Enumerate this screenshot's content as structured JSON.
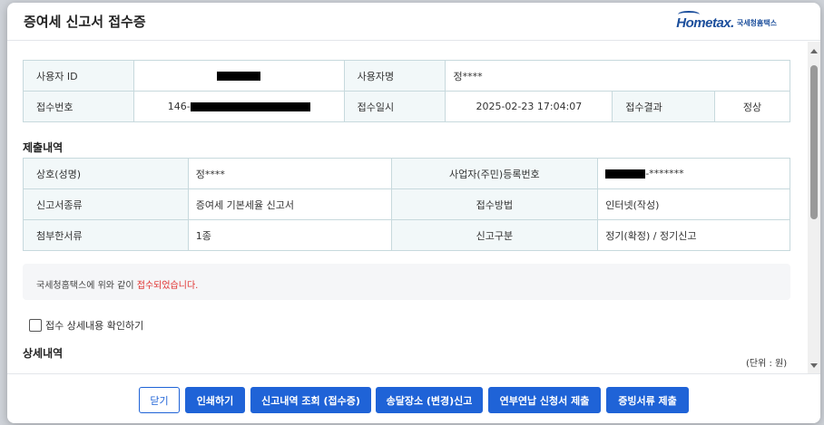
{
  "modal": {
    "title": "증여세 신고서 접수증",
    "logo_mark": "Hometax.",
    "logo_sub": "국세청홈택스"
  },
  "receipt": {
    "user_id_label": "사용자 ID",
    "user_name_label": "사용자명",
    "user_name_value": "정****",
    "receipt_no_label": "접수번호",
    "receipt_no_prefix": "146-",
    "receipt_date_label": "접수일시",
    "receipt_date_value": "2025-02-23 17:04:07",
    "receipt_result_label": "접수결과",
    "receipt_result_value": "정상"
  },
  "submission": {
    "section_title": "제출내역",
    "trade_name_label": "상호(성명)",
    "trade_name_value": "정****",
    "reg_no_label": "사업자(주민)등록번호",
    "reg_no_suffix": "-*******",
    "form_type_label": "신고서종류",
    "form_type_value": "증여세 기본세율 신고서",
    "method_label": "접수방법",
    "method_value": "인터넷(작성)",
    "attach_label": "첨부한서류",
    "attach_value": "1종",
    "category_label": "신고구분",
    "category_value": "정기(확정) / 정기신고"
  },
  "notice": {
    "text": "국세청홈택스에 위와 같이 ",
    "highlight": "접수되었습니다."
  },
  "detail_check": {
    "label": "접수 상세내용 확인하기"
  },
  "details": {
    "section_title": "상세내역",
    "unit": "(단위 : 원)"
  },
  "buttons": {
    "close": "닫기",
    "print": "인쇄하기",
    "history": "신고내역 조회 (접수증)",
    "address": "송달장소 (변경)신고",
    "yearend": "연부연납 신청서 제출",
    "evidence": "증빙서류 제출"
  },
  "colors": {
    "primary": "#1f63d7",
    "label_bg": "#f2f8f9",
    "highlight": "#e0312f"
  }
}
